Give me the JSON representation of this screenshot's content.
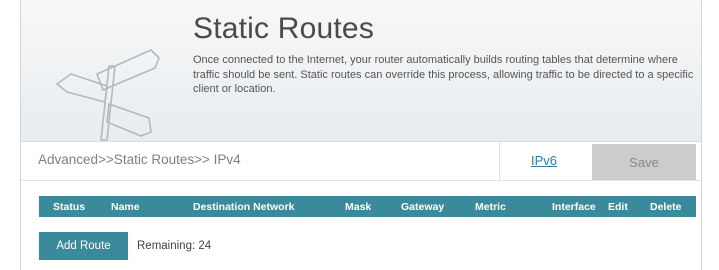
{
  "header": {
    "title": "Static Routes",
    "description": "Once connected to the Internet, your router automatically builds routing tables that determine where traffic should be sent. Static routes can override this process, allowing traffic to be directed to a specific client or location.",
    "icon": "signpost-icon"
  },
  "breadcrumb": "Advanced>>Static Routes>> IPv4",
  "nav": {
    "ipv6_label": "IPv6",
    "save_label": "Save"
  },
  "table": {
    "columns": [
      "Status",
      "Name",
      "Destination Network",
      "Mask",
      "Gateway",
      "Metric",
      "Interface",
      "Edit",
      "Delete"
    ]
  },
  "actions": {
    "add_route_label": "Add Route",
    "remaining_text": "Remaining: 24"
  },
  "colors": {
    "accent": "#3b8a9b",
    "save_disabled": "#cccccc",
    "link": "#2d7fa4"
  }
}
